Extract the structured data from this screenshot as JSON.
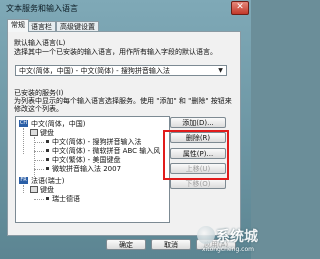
{
  "window": {
    "title": "文本服务和输入语言",
    "close_label": "✕"
  },
  "tabs": [
    "常规",
    "语言栏",
    "高级键设置"
  ],
  "default_language": {
    "heading": "默认输入语言(L)",
    "description": "选择其中一个已安装的输入语言，用作所有输入字段的默认语言。",
    "selected": "中文(简体，中国) - 中文(简体) - 搜狗拼音输入法"
  },
  "installed_services": {
    "heading": "已安装的服务(I)",
    "description": "为列表中显示的每个输入语言选择服务。使用 \"添加\" 和 \"删除\" 按钮来修改这个列表。",
    "tree": {
      "lang1": "中文(简体，中国)",
      "kb_group": "键盘",
      "kb_items": [
        "中文(简体) - 搜狗拼音输入法",
        "中文(简体) - 微软拼音 ABC 输入风",
        "中文(繁体) - 美国键盘",
        "微软拼音输入法 2007"
      ],
      "lang2": "法语(瑞士)",
      "lang2_group": "键盘",
      "lang2_items": [
        "瑞士德语"
      ]
    }
  },
  "buttons": {
    "add": "添加(D)...",
    "remove": "删除(R)",
    "properties": "属性(P)...",
    "move_up": "上移(U)",
    "move_down": "下移(O)",
    "ok": "确定",
    "cancel": "取消",
    "apply": "应用(A)"
  },
  "watermark": {
    "brand": "系统城",
    "url": "xitongcheng.com"
  },
  "colors": {
    "highlight": "#e11b1b",
    "title_bar": "#7fa9b7"
  }
}
